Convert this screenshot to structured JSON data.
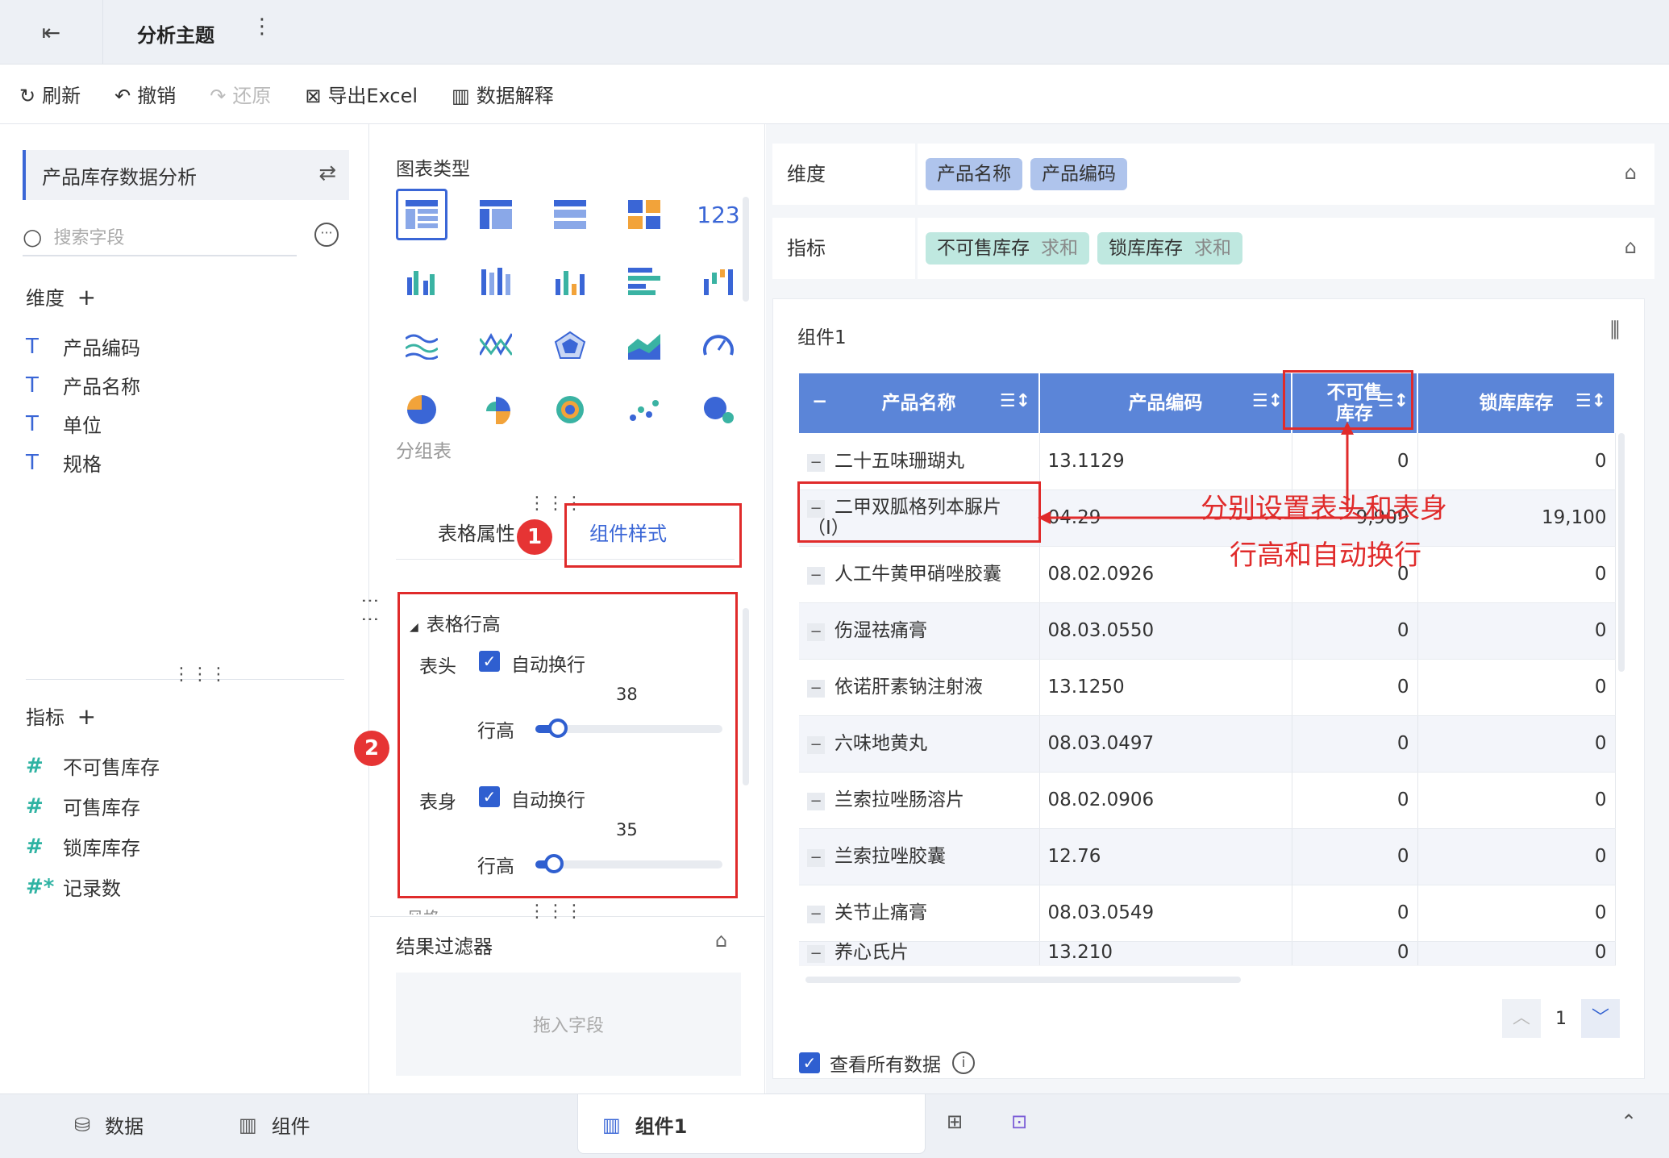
{
  "header": {
    "title": "分析主题",
    "more": "⋮",
    "back_icon": "⇤"
  },
  "toolbar": {
    "refresh": "刷新",
    "undo": "撤销",
    "redo": "还原",
    "export": "导出Excel",
    "explain": "数据解释"
  },
  "left": {
    "dataset": "产品库存数据分析",
    "search_placeholder": "搜索字段",
    "dims_title": "维度",
    "dims": [
      "产品编码",
      "产品名称",
      "单位",
      "规格"
    ],
    "metrics_title": "指标",
    "metrics": [
      "不可售库存",
      "可售库存",
      "锁库库存",
      "记录数"
    ]
  },
  "mid": {
    "chart_type_title": "图表类型",
    "chart_sub": "分组表",
    "tab_props": "表格属性",
    "tab_style": "组件样式",
    "badge1": "1",
    "badge2": "2",
    "section": "表格行高",
    "header_label": "表头",
    "auto_wrap": "自动换行",
    "header_value": "38",
    "row_height": "行高",
    "body_label": "表身",
    "body_value": "35",
    "next_section": "风格",
    "header_fraction": 0.12,
    "body_fraction": 0.1,
    "filter_title": "结果过滤器",
    "drop_hint": "拖入字段"
  },
  "right": {
    "dim_label": "维度",
    "dim_pills": [
      "产品名称",
      "产品编码"
    ],
    "metric_label": "指标",
    "metric_pills": [
      {
        "name": "不可售库存",
        "agg": "求和"
      },
      {
        "name": "锁库库存",
        "agg": "求和"
      }
    ],
    "card_title": "组件1",
    "columns": [
      "产品名称",
      "产品编码",
      "不可售\n库存",
      "锁库库存"
    ],
    "rows": [
      [
        "二十五味珊瑚丸",
        "13.1129",
        "0",
        "0"
      ],
      [
        "二甲双胍格列本脲片（Ⅰ）",
        "04.29",
        "9,909",
        "19,100"
      ],
      [
        "人工牛黄甲硝唑胶囊",
        "08.02.0926",
        "0",
        "0"
      ],
      [
        "伤湿祛痛膏",
        "08.03.0550",
        "0",
        "0"
      ],
      [
        "依诺肝素钠注射液",
        "13.1250",
        "0",
        "0"
      ],
      [
        "六味地黄丸",
        "08.03.0497",
        "0",
        "0"
      ],
      [
        "兰索拉唑肠溶片",
        "08.02.0906",
        "0",
        "0"
      ],
      [
        "兰索拉唑胶囊",
        "12.76",
        "0",
        "0"
      ],
      [
        "关节止痛膏",
        "08.03.0549",
        "0",
        "0"
      ],
      [
        "养心氏片",
        "13.210",
        "0",
        "0"
      ]
    ],
    "page": "1",
    "view_all": "查看所有数据",
    "annotation": [
      "分别设置表头和表身",
      "行高和自动换行"
    ]
  },
  "bottom": {
    "data": "数据",
    "component": "组件",
    "current": "组件1"
  }
}
